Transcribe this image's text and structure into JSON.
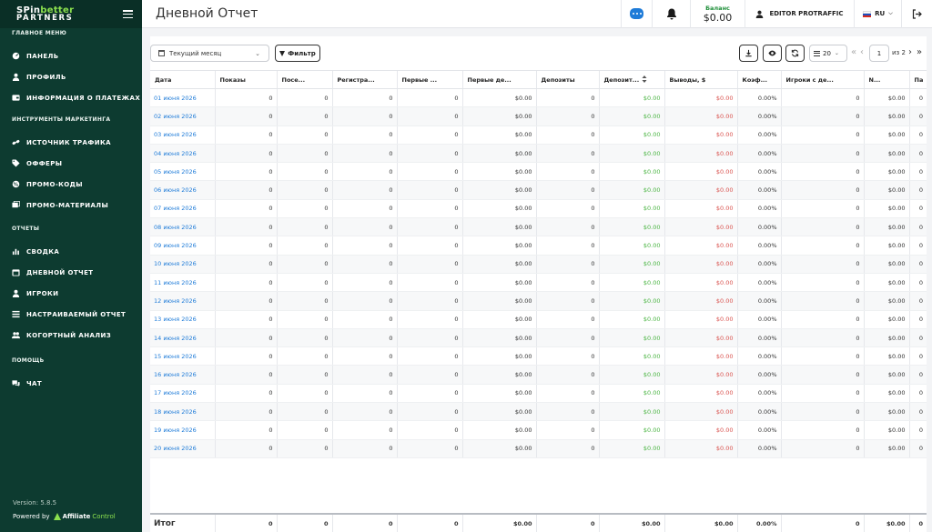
{
  "sidebar": {
    "logo": {
      "line1_a": "SPin",
      "line1_b": "better",
      "line2": "PARTNERS"
    },
    "sections": [
      {
        "title": "ГЛАВНОЕ МЕНЮ",
        "items": [
          {
            "label": "ПАНЕЛЬ",
            "icon": "dashboard-icon"
          },
          {
            "label": "ПРОФИЛЬ",
            "icon": "user-icon"
          },
          {
            "label": "ИНФОРМАЦИЯ О ПЛАТЕЖАХ",
            "icon": "wallet-icon"
          }
        ]
      },
      {
        "title": "ИНСТРУМЕНТЫ МАРКЕТИНГА",
        "items": [
          {
            "label": "ИСТОЧНИК ТРАФИКА",
            "icon": "link-icon"
          },
          {
            "label": "ОФФЕРЫ",
            "icon": "tag-icon"
          },
          {
            "label": "ПРОМО-КОДЫ",
            "icon": "promo-icon"
          },
          {
            "label": "ПРОМО-МАТЕРИАЛЫ",
            "icon": "images-icon"
          }
        ]
      },
      {
        "title": "ОТЧЕТЫ",
        "items": [
          {
            "label": "СВОДКА",
            "icon": "chart-icon"
          },
          {
            "label": "ДНЕВНОЙ ОТЧЕТ",
            "icon": "calendar-icon"
          },
          {
            "label": "ИГРОКИ",
            "icon": "player-icon"
          },
          {
            "label": "НАСТРАИВАЕМЫЙ ОТЧЕТ",
            "icon": "list-icon"
          },
          {
            "label": "КОГОРТНЫЙ АНАЛИЗ",
            "icon": "users-icon"
          }
        ]
      },
      {
        "title": "ПОМОЩЬ",
        "items": [
          {
            "label": "ЧАТ",
            "icon": "chat-icon"
          }
        ]
      }
    ],
    "version": "Version: 5.8.5",
    "powered_by": "Powered by",
    "powered_brand_a": "Affiliate",
    "powered_brand_b": "Control"
  },
  "header": {
    "title": "Дневной Отчет",
    "balance_label": "Баланс",
    "balance_value": "$0.00",
    "user_name": "EDITOR PROTRAFFIC",
    "language": "RU"
  },
  "toolbar": {
    "period": "Текущий месяц",
    "filter_label": "Фильтр",
    "per_page": "20",
    "page": "1",
    "page_of": "из 2"
  },
  "table": {
    "columns": [
      "Дата",
      "Показы",
      "Посе...",
      "Регистра...",
      "Первые ...",
      "Первые де...",
      "Депозиты",
      "Депозит...",
      "Выводы, $",
      "Коэф...",
      "Игроки с де...",
      "N...",
      "Па"
    ],
    "rows": [
      [
        "01 июня 2026",
        "0",
        "0",
        "0",
        "0",
        "$0.00",
        "0",
        "$0.00",
        "$0.00",
        "0.00%",
        "0",
        "$0.00",
        "0"
      ],
      [
        "02 июня 2026",
        "0",
        "0",
        "0",
        "0",
        "$0.00",
        "0",
        "$0.00",
        "$0.00",
        "0.00%",
        "0",
        "$0.00",
        "0"
      ],
      [
        "03 июня 2026",
        "0",
        "0",
        "0",
        "0",
        "$0.00",
        "0",
        "$0.00",
        "$0.00",
        "0.00%",
        "0",
        "$0.00",
        "0"
      ],
      [
        "04 июня 2026",
        "0",
        "0",
        "0",
        "0",
        "$0.00",
        "0",
        "$0.00",
        "$0.00",
        "0.00%",
        "0",
        "$0.00",
        "0"
      ],
      [
        "05 июня 2026",
        "0",
        "0",
        "0",
        "0",
        "$0.00",
        "0",
        "$0.00",
        "$0.00",
        "0.00%",
        "0",
        "$0.00",
        "0"
      ],
      [
        "06 июня 2026",
        "0",
        "0",
        "0",
        "0",
        "$0.00",
        "0",
        "$0.00",
        "$0.00",
        "0.00%",
        "0",
        "$0.00",
        "0"
      ],
      [
        "07 июня 2026",
        "0",
        "0",
        "0",
        "0",
        "$0.00",
        "0",
        "$0.00",
        "$0.00",
        "0.00%",
        "0",
        "$0.00",
        "0"
      ],
      [
        "08 июня 2026",
        "0",
        "0",
        "0",
        "0",
        "$0.00",
        "0",
        "$0.00",
        "$0.00",
        "0.00%",
        "0",
        "$0.00",
        "0"
      ],
      [
        "09 июня 2026",
        "0",
        "0",
        "0",
        "0",
        "$0.00",
        "0",
        "$0.00",
        "$0.00",
        "0.00%",
        "0",
        "$0.00",
        "0"
      ],
      [
        "10 июня 2026",
        "0",
        "0",
        "0",
        "0",
        "$0.00",
        "0",
        "$0.00",
        "$0.00",
        "0.00%",
        "0",
        "$0.00",
        "0"
      ],
      [
        "11 июня 2026",
        "0",
        "0",
        "0",
        "0",
        "$0.00",
        "0",
        "$0.00",
        "$0.00",
        "0.00%",
        "0",
        "$0.00",
        "0"
      ],
      [
        "12 июня 2026",
        "0",
        "0",
        "0",
        "0",
        "$0.00",
        "0",
        "$0.00",
        "$0.00",
        "0.00%",
        "0",
        "$0.00",
        "0"
      ],
      [
        "13 июня 2026",
        "0",
        "0",
        "0",
        "0",
        "$0.00",
        "0",
        "$0.00",
        "$0.00",
        "0.00%",
        "0",
        "$0.00",
        "0"
      ],
      [
        "14 июня 2026",
        "0",
        "0",
        "0",
        "0",
        "$0.00",
        "0",
        "$0.00",
        "$0.00",
        "0.00%",
        "0",
        "$0.00",
        "0"
      ],
      [
        "15 июня 2026",
        "0",
        "0",
        "0",
        "0",
        "$0.00",
        "0",
        "$0.00",
        "$0.00",
        "0.00%",
        "0",
        "$0.00",
        "0"
      ],
      [
        "16 июня 2026",
        "0",
        "0",
        "0",
        "0",
        "$0.00",
        "0",
        "$0.00",
        "$0.00",
        "0.00%",
        "0",
        "$0.00",
        "0"
      ],
      [
        "17 июня 2026",
        "0",
        "0",
        "0",
        "0",
        "$0.00",
        "0",
        "$0.00",
        "$0.00",
        "0.00%",
        "0",
        "$0.00",
        "0"
      ],
      [
        "18 июня 2026",
        "0",
        "0",
        "0",
        "0",
        "$0.00",
        "0",
        "$0.00",
        "$0.00",
        "0.00%",
        "0",
        "$0.00",
        "0"
      ],
      [
        "19 июня 2026",
        "0",
        "0",
        "0",
        "0",
        "$0.00",
        "0",
        "$0.00",
        "$0.00",
        "0.00%",
        "0",
        "$0.00",
        "0"
      ],
      [
        "20 июня 2026",
        "0",
        "0",
        "0",
        "0",
        "$0.00",
        "0",
        "$0.00",
        "$0.00",
        "0.00%",
        "0",
        "$0.00",
        "0"
      ]
    ],
    "totals": [
      "Итог",
      "0",
      "0",
      "0",
      "0",
      "$0.00",
      "0",
      "$0.00",
      "$0.00",
      "0.00%",
      "0",
      "$0.00",
      "0"
    ]
  },
  "colors": {
    "sidebar_bg": "#0d3b30",
    "brand_green": "#8be04e",
    "link_blue": "#1e7bd8",
    "deposit_green": "#4bb543",
    "withdraw_red": "#d9534f"
  }
}
